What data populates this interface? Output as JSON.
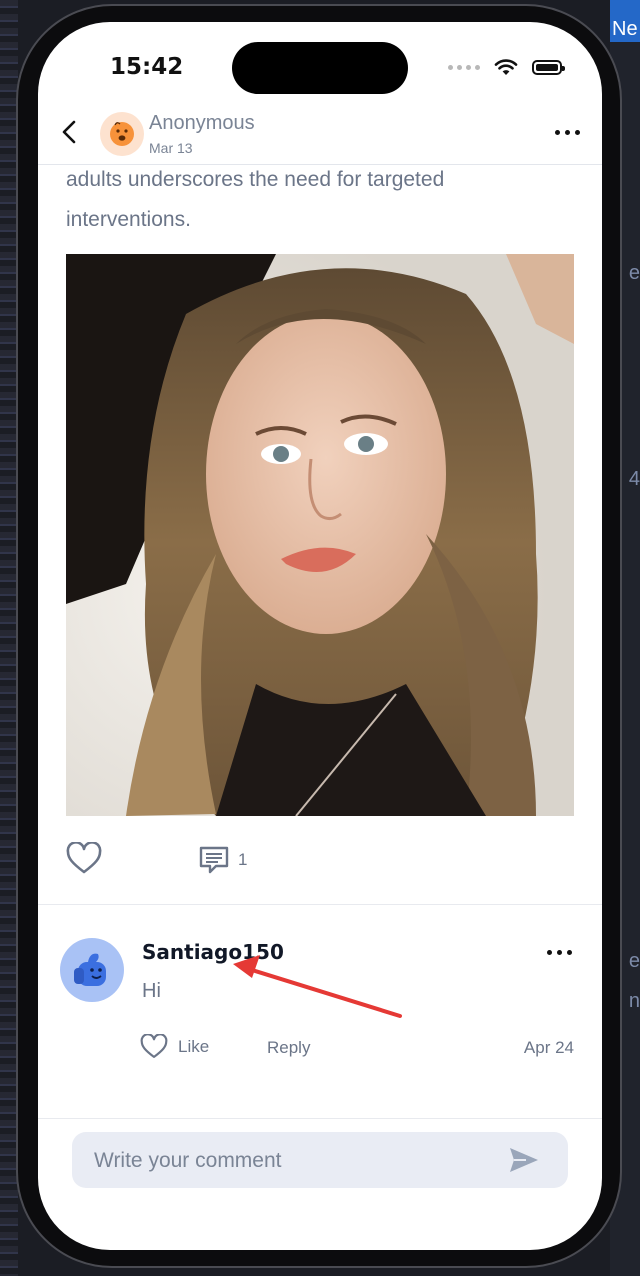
{
  "status_bar": {
    "time": "15:42"
  },
  "post": {
    "author": "Anonymous",
    "date": "Mar 13",
    "text_lines": [
      "adults underscores the need for targeted",
      "interventions."
    ],
    "comment_count": "1"
  },
  "comment": {
    "username": "Santiago150",
    "text": "Hi",
    "like_label": "Like",
    "reply_label": "Reply",
    "date": "Apr 24"
  },
  "composer": {
    "placeholder": "Write your comment"
  },
  "background": {
    "tab_text": "Ne",
    "side_letters": [
      "e",
      "4",
      "e",
      "n"
    ]
  },
  "colors": {
    "accent": "#2468c8",
    "annotation_arrow": "#e53935",
    "muted_text": "#6b7588"
  }
}
